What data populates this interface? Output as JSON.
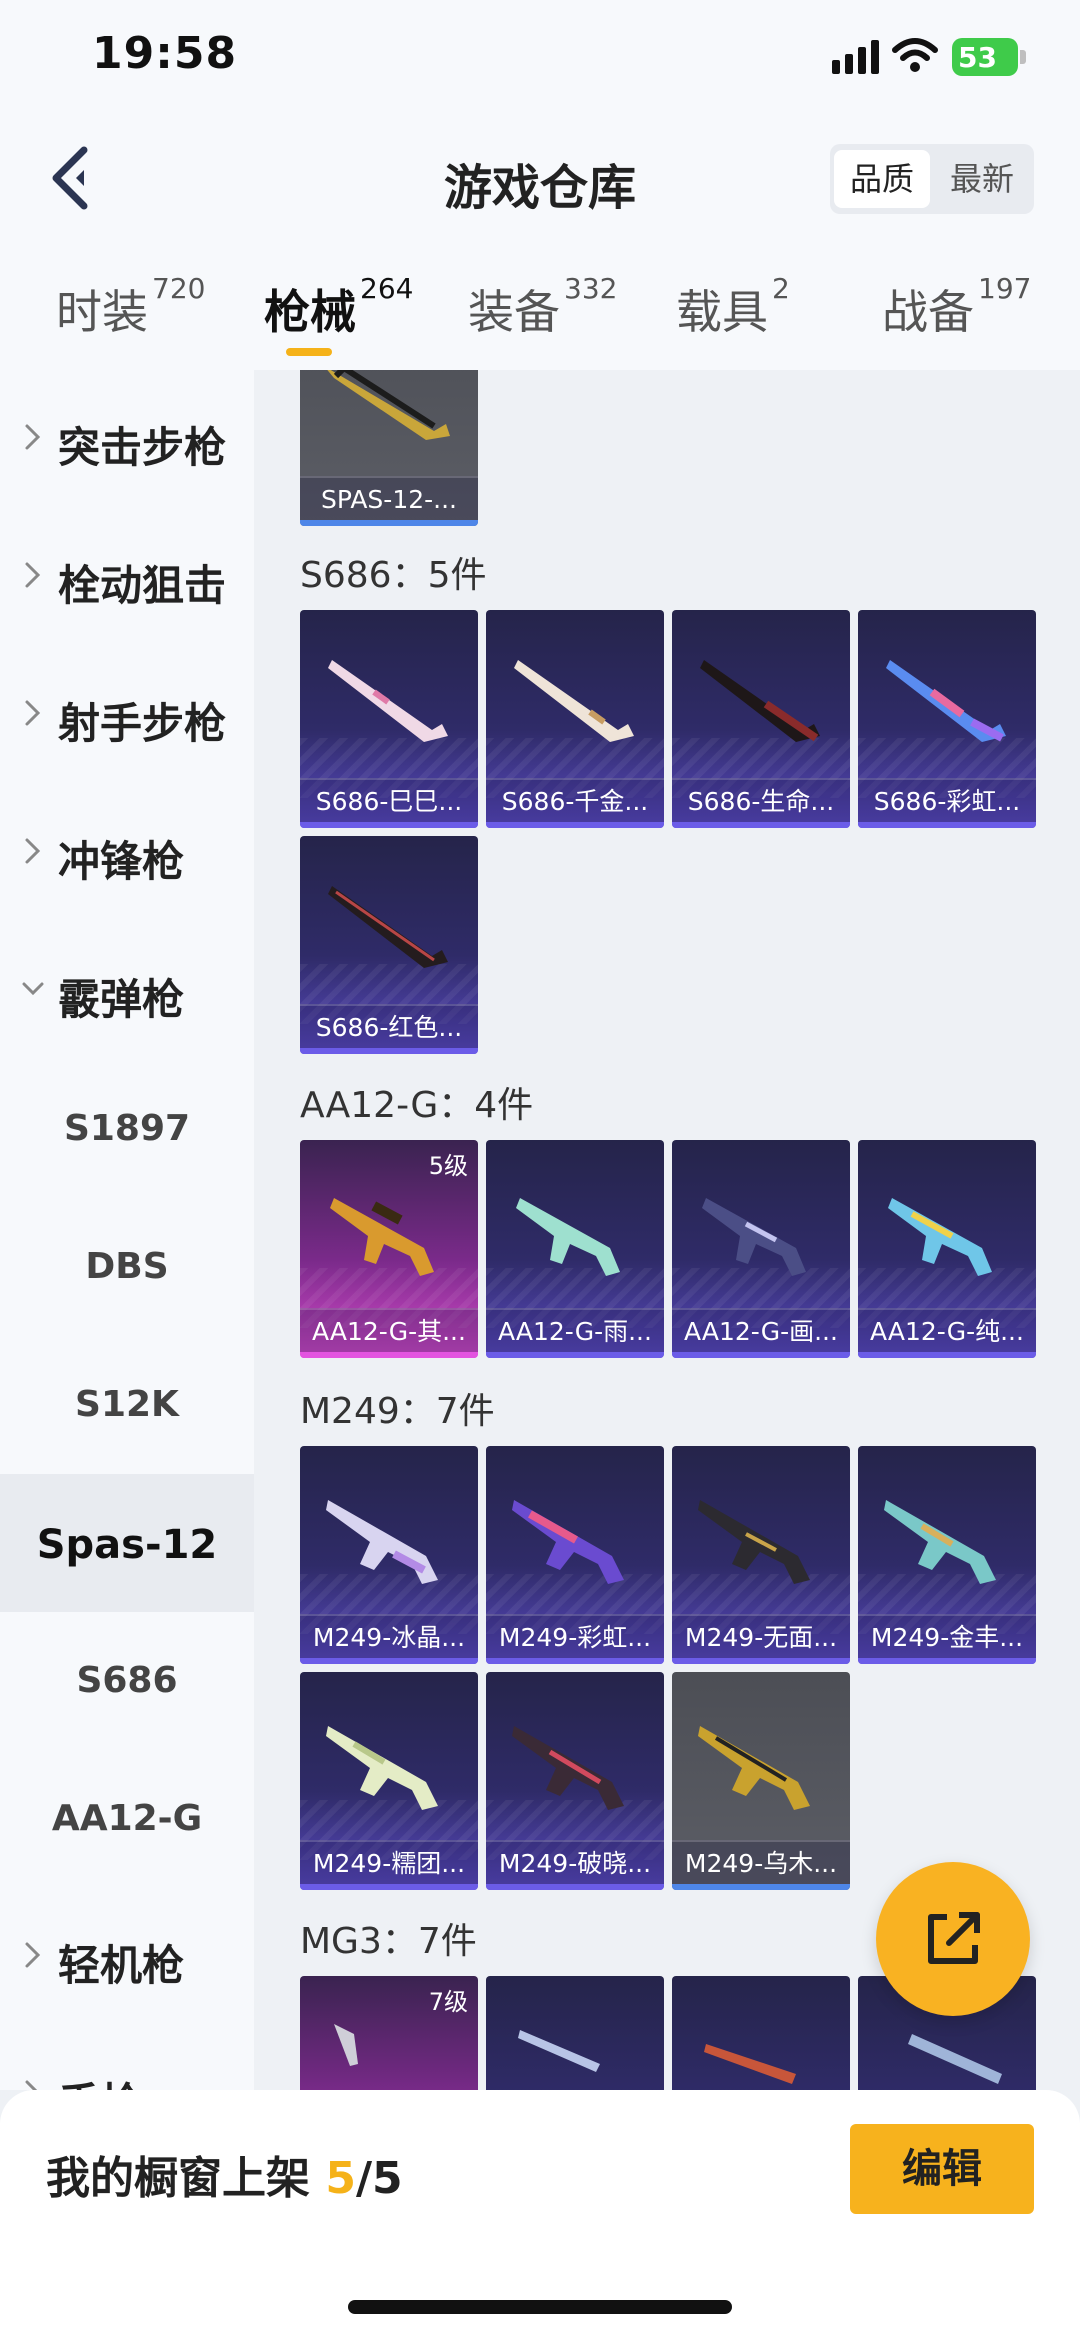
{
  "status_bar": {
    "time": "19:58",
    "battery": "53"
  },
  "header": {
    "title": "游戏仓库",
    "sort_options": [
      "品质",
      "最新"
    ]
  },
  "tabs": [
    {
      "label": "时装",
      "count": "720"
    },
    {
      "label": "枪械",
      "count": "264",
      "active": true
    },
    {
      "label": "装备",
      "count": "332"
    },
    {
      "label": "载具",
      "count": "2"
    },
    {
      "label": "战备",
      "count": "197"
    }
  ],
  "sidebar": {
    "categories": [
      "突击步枪",
      "栓动狙击",
      "射手步枪",
      "冲锋枪",
      "霰弹枪",
      "轻机枪",
      "手枪"
    ],
    "subitems": [
      "S1897",
      "DBS",
      "S12K",
      "Spas-12",
      "S686",
      "AA12-G"
    ],
    "active_subitem": "Spas-12"
  },
  "sections": [
    {
      "title": "",
      "cards": [
        "SPAS-12-..."
      ]
    },
    {
      "title": "S686：5件",
      "cards": [
        "S686-巳巳...",
        "S686-千金...",
        "S686-生命...",
        "S686-彩虹...",
        "S686-红色..."
      ]
    },
    {
      "title": "AA12-G：4件",
      "cards": [
        "AA12-G-其...",
        "AA12-G-雨...",
        "AA12-G-画...",
        "AA12-G-纯..."
      ],
      "levels": [
        "5级"
      ]
    },
    {
      "title": "M249：7件",
      "cards": [
        "M249-冰晶...",
        "M249-彩虹...",
        "M249-无面...",
        "M249-金丰...",
        "M249-糯团...",
        "M249-破晓...",
        "M249-乌木..."
      ]
    },
    {
      "title": "MG3：7件",
      "levels": [
        "7级"
      ]
    }
  ],
  "bottom_bar": {
    "showcase_label": "我的橱窗上架",
    "showcase_count": "5",
    "showcase_total": "/5",
    "edit_label": "编辑"
  },
  "icons": {
    "back": "chevron-left-icon",
    "share": "external-link-icon",
    "signal": "cellular-signal-icon",
    "wifi": "wifi-icon"
  },
  "colors": {
    "accent": "#f5b219",
    "purple_rarity": "#6b5ce8",
    "pink_rarity": "#e354e0",
    "blue_rarity": "#4e86e8"
  }
}
